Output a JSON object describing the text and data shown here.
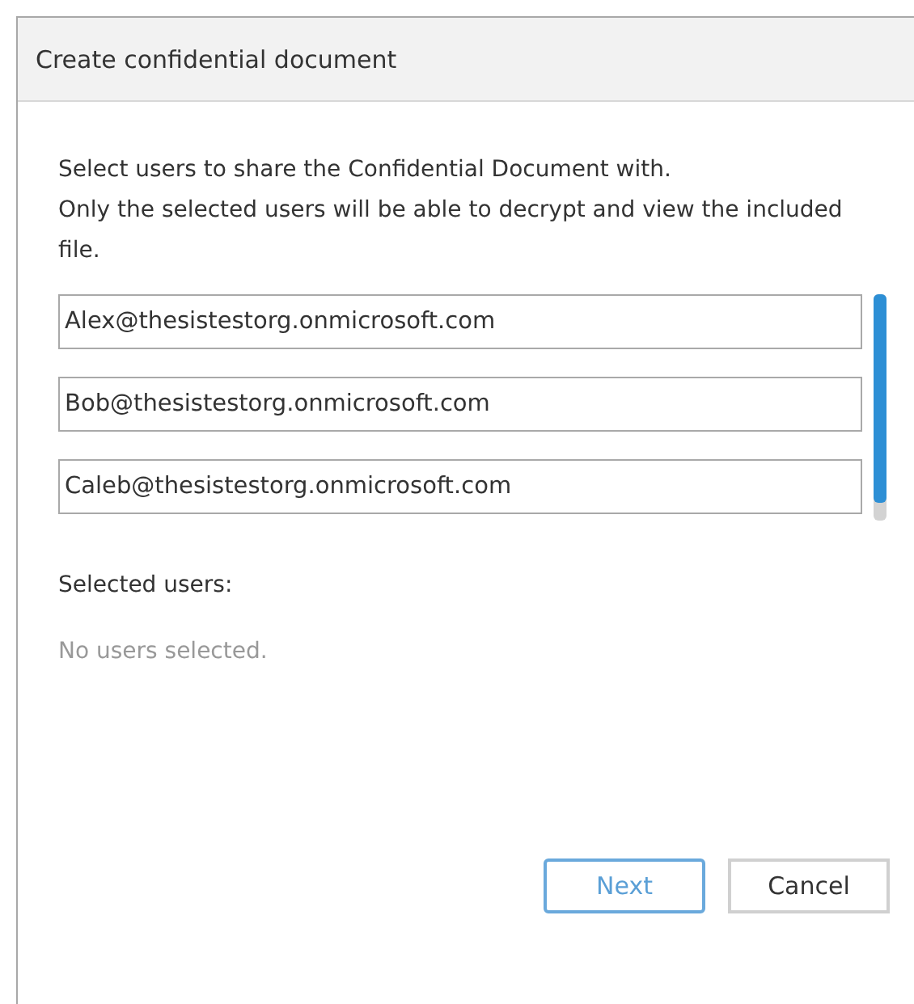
{
  "dialog": {
    "title": "Create confidential document"
  },
  "instructions": [
    "Select users to share the Confidential Document with.",
    "Only the selected users will be able to decrypt and view the included file."
  ],
  "user_fields": [
    {
      "value": "Alex@thesistestorg.onmicrosoft.com"
    },
    {
      "value": "Bob@thesistestorg.onmicrosoft.com"
    },
    {
      "value": "Caleb@thesistestorg.onmicrosoft.com"
    }
  ],
  "selected_users": {
    "label": "Selected users:",
    "empty_text": "No users selected."
  },
  "buttons": [
    {
      "label": "Next",
      "kind": "primary"
    },
    {
      "label": "Cancel",
      "kind": "secondary"
    }
  ]
}
